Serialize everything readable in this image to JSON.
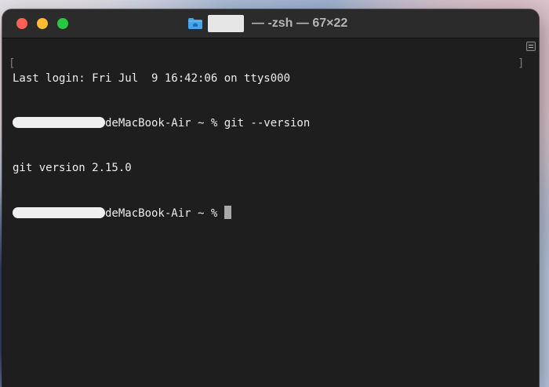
{
  "window": {
    "title_suffix": "— -zsh — 67×22",
    "folder_icon": "folder-home-icon"
  },
  "terminal": {
    "lines": [
      "Last login: Fri Jul  9 16:42:06 on ttys000",
      "deMacBook-Air ~ % git --version",
      "git version 2.15.0",
      "deMacBook-Air ~ % "
    ],
    "bracket_left": "[",
    "bracket_right": "]"
  },
  "colors": {
    "close": "#fe5f57",
    "minimize": "#febc2e",
    "zoom": "#28c840",
    "terminal_bg": "#1e1e1e",
    "terminal_fg": "#ededed"
  }
}
